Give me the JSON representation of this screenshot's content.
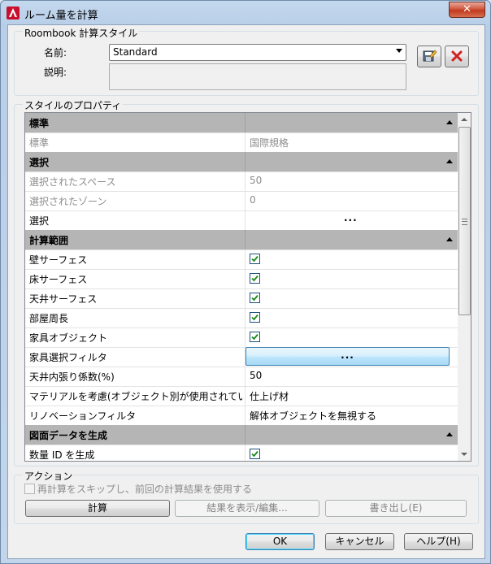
{
  "window": {
    "title": "ルーム量を計算",
    "close_glyph": "✕"
  },
  "style_group": {
    "label": "Roombook 計算スタイル",
    "name_label": "名前:",
    "name_value": "Standard",
    "description_label": "説明:",
    "description_value": ""
  },
  "properties": {
    "label": "スタイルのプロパティ",
    "rows": [
      {
        "type": "category",
        "name": "標準"
      },
      {
        "type": "text",
        "name": "標準",
        "value": "国際規格",
        "dim": true
      },
      {
        "type": "category",
        "name": "選択"
      },
      {
        "type": "text",
        "name": "選択されたスペース",
        "value": "50",
        "dim": true
      },
      {
        "type": "text",
        "name": "選択されたゾーン",
        "value": "0",
        "dim": true
      },
      {
        "type": "ellipsis",
        "name": "選択",
        "value": "..."
      },
      {
        "type": "category",
        "name": "計算範囲"
      },
      {
        "type": "check",
        "name": "壁サーフェス",
        "checked": true
      },
      {
        "type": "check",
        "name": "床サーフェス",
        "checked": true
      },
      {
        "type": "check",
        "name": "天井サーフェス",
        "checked": true
      },
      {
        "type": "check",
        "name": "部屋周長",
        "checked": true
      },
      {
        "type": "check",
        "name": "家具オブジェクト",
        "checked": true
      },
      {
        "type": "ellipsis-button",
        "name": "家具選択フィルタ",
        "value": "..."
      },
      {
        "type": "text",
        "name": "天井内張り係数(%)",
        "value": "50"
      },
      {
        "type": "text",
        "name": "マテリアルを考慮(オブジェクト別が使用されてい",
        "value": "仕上げ材"
      },
      {
        "type": "text",
        "name": "リノベーションフィルタ",
        "value": "解体オブジェクトを無視する"
      },
      {
        "type": "category",
        "name": "図面データを生成"
      },
      {
        "type": "check",
        "name": "数量 ID を生成",
        "checked": true
      }
    ]
  },
  "actions": {
    "label": "アクション",
    "reuse_checkbox": "再計算をスキップし、前回の計算結果を使用する",
    "calculate": "計算",
    "show_results": "結果を表示/編集...",
    "export": "書き出し(E)"
  },
  "footer": {
    "ok": "OK",
    "cancel": "キャンセル",
    "help": "ヘルプ(H)"
  },
  "colors": {
    "category_bg": "#b5b5b5",
    "dim_text": "#8d8d8d",
    "accent": "#3c7fb1"
  }
}
